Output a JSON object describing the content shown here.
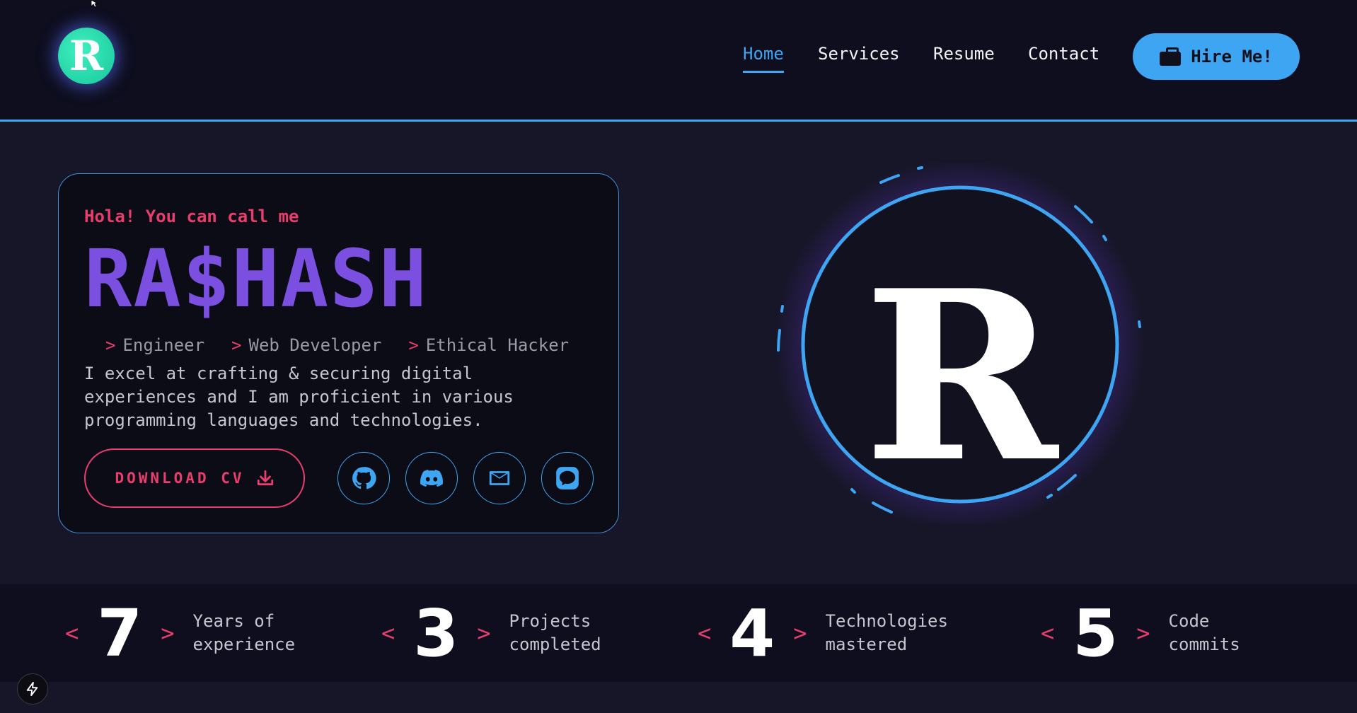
{
  "header": {
    "logo_letter": "R",
    "nav": [
      {
        "label": "Home",
        "active": true
      },
      {
        "label": "Services",
        "active": false
      },
      {
        "label": "Resume",
        "active": false
      },
      {
        "label": "Contact",
        "active": false
      }
    ],
    "hire_label": "Hire Me!"
  },
  "hero": {
    "greeting": "Hola! You can call me",
    "name": "RA$HASH",
    "roles": [
      "Engineer",
      "Web Developer",
      "Ethical Hacker"
    ],
    "role_prefix": ">",
    "bio": "I excel at crafting & securing digital experiences and I am proficient in various programming languages and technologies.",
    "cv_label": "DOWNLOAD CV",
    "socials": [
      "github-icon",
      "discord-icon",
      "mail-icon",
      "chat-icon"
    ],
    "emblem_letter": "R"
  },
  "stats": [
    {
      "number": "7",
      "label": "Years of\nexperience"
    },
    {
      "number": "3",
      "label": "Projects\ncompleted"
    },
    {
      "number": "4",
      "label": "Technologies\nmastered"
    },
    {
      "number": "5",
      "label": "Code\ncommits"
    }
  ],
  "stat_open": "<",
  "stat_close": ">",
  "colors": {
    "accent_blue": "#3ea5f3",
    "accent_pink": "#e93d6d",
    "name_purple": "#7b4fe0",
    "logo_green": "#19c79a",
    "background": "#161628"
  }
}
